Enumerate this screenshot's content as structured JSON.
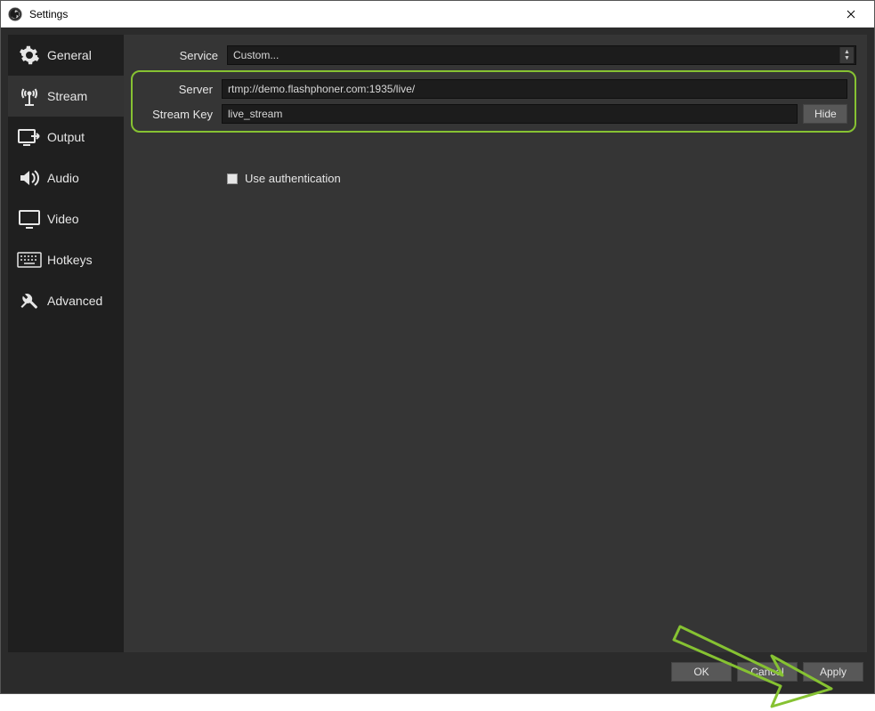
{
  "window": {
    "title": "Settings"
  },
  "sidebar": {
    "items": [
      {
        "key": "general",
        "label": "General"
      },
      {
        "key": "stream",
        "label": "Stream"
      },
      {
        "key": "output",
        "label": "Output"
      },
      {
        "key": "audio",
        "label": "Audio"
      },
      {
        "key": "video",
        "label": "Video"
      },
      {
        "key": "hotkeys",
        "label": "Hotkeys"
      },
      {
        "key": "advanced",
        "label": "Advanced"
      }
    ],
    "active": "stream"
  },
  "form": {
    "service_label": "Service",
    "service_value": "Custom...",
    "server_label": "Server",
    "server_value": "rtmp://demo.flashphoner.com:1935/live/",
    "streamkey_label": "Stream Key",
    "streamkey_value": "live_stream",
    "hide_button": "Hide",
    "auth_label": "Use authentication",
    "auth_checked": false
  },
  "footer": {
    "ok": "OK",
    "cancel": "Cancel",
    "apply": "Apply"
  },
  "annotation": {
    "highlight_color": "#86c232"
  }
}
